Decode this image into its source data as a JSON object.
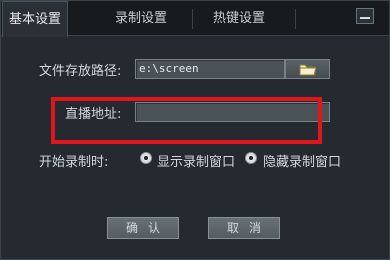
{
  "tabs": [
    {
      "label": "基本设置",
      "active": true
    },
    {
      "label": "录制设置",
      "active": false
    },
    {
      "label": "热键设置",
      "active": false
    }
  ],
  "form": {
    "path_label": "文件存放路径:",
    "path_value": "e:\\screen",
    "folder_icon": "folder-icon",
    "stream_label": "直播地址:",
    "stream_value": "",
    "start_label": "开始录制时:",
    "option_show": "显示录制窗口",
    "option_hide": "隐藏录制窗口"
  },
  "buttons": {
    "ok": "确认",
    "cancel": "取消"
  },
  "colors": {
    "highlight": "#e0161c",
    "background": "#242a2f"
  }
}
